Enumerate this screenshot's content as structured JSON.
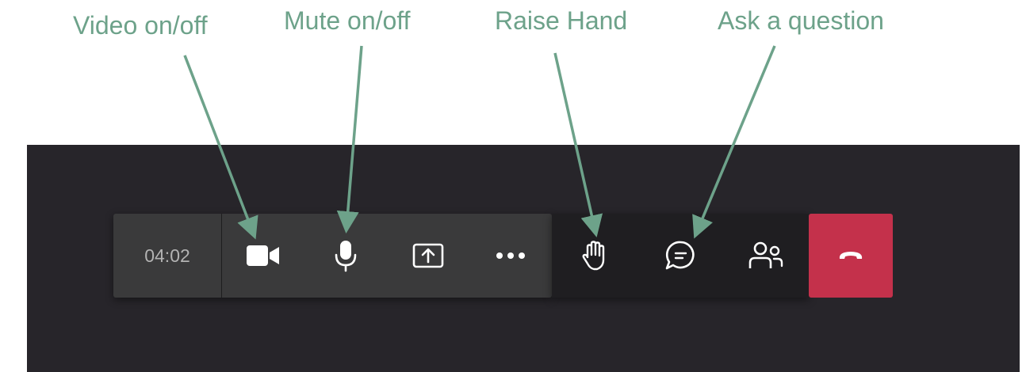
{
  "annotations": {
    "video": "Video on/off",
    "mute": "Mute on/off",
    "raise_hand": "Raise Hand",
    "ask_question": "Ask a question"
  },
  "call_controls": {
    "timer": "04:02",
    "buttons": [
      {
        "icon": "video-camera-icon"
      },
      {
        "icon": "microphone-icon"
      },
      {
        "icon": "share-screen-icon"
      },
      {
        "icon": "more-options-icon"
      },
      {
        "icon": "raise-hand-icon"
      },
      {
        "icon": "chat-icon"
      },
      {
        "icon": "participants-icon"
      },
      {
        "icon": "hang-up-icon"
      }
    ]
  },
  "colors": {
    "annotation": "#6da28a",
    "background": "#27252a",
    "toolbar": "#3a3a3b",
    "toolbar_dark": "#1f1e21",
    "leave": "#c4314b"
  }
}
